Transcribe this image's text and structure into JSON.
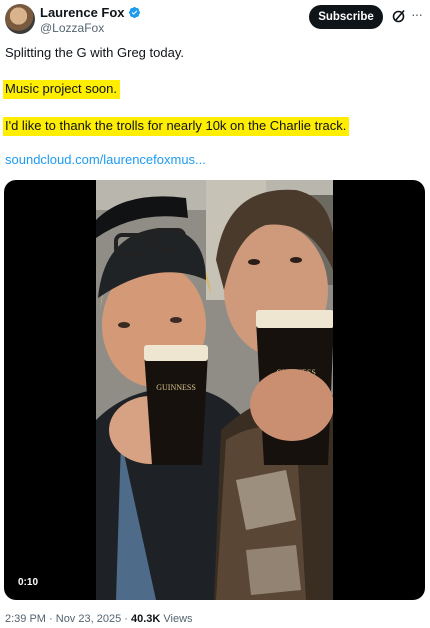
{
  "author": {
    "name": "Laurence Fox",
    "handle": "@LozzaFox",
    "verified": true,
    "verified_color": "#1d9bf0"
  },
  "actions": {
    "subscribe_label": "Subscribe",
    "more_label": "···"
  },
  "tweet": {
    "line1": "Splitting the G with Greg today.",
    "highlight1": "Music project soon.",
    "highlight2": "I'd like to thank the trolls for nearly 10k on the Charlie track.",
    "highlight_color": "#ffee00",
    "link": "soundcloud.com/laurencefoxmus..."
  },
  "video": {
    "duration": "0:10",
    "glass_label_left": "GUINNESS",
    "glass_label_right": "GUINNESS"
  },
  "meta": {
    "time": "2:39 PM",
    "sep1": " · ",
    "date": "Nov 23, 2025",
    "sep2": " · ",
    "views_count": "40.3K",
    "views_label": " Views"
  }
}
